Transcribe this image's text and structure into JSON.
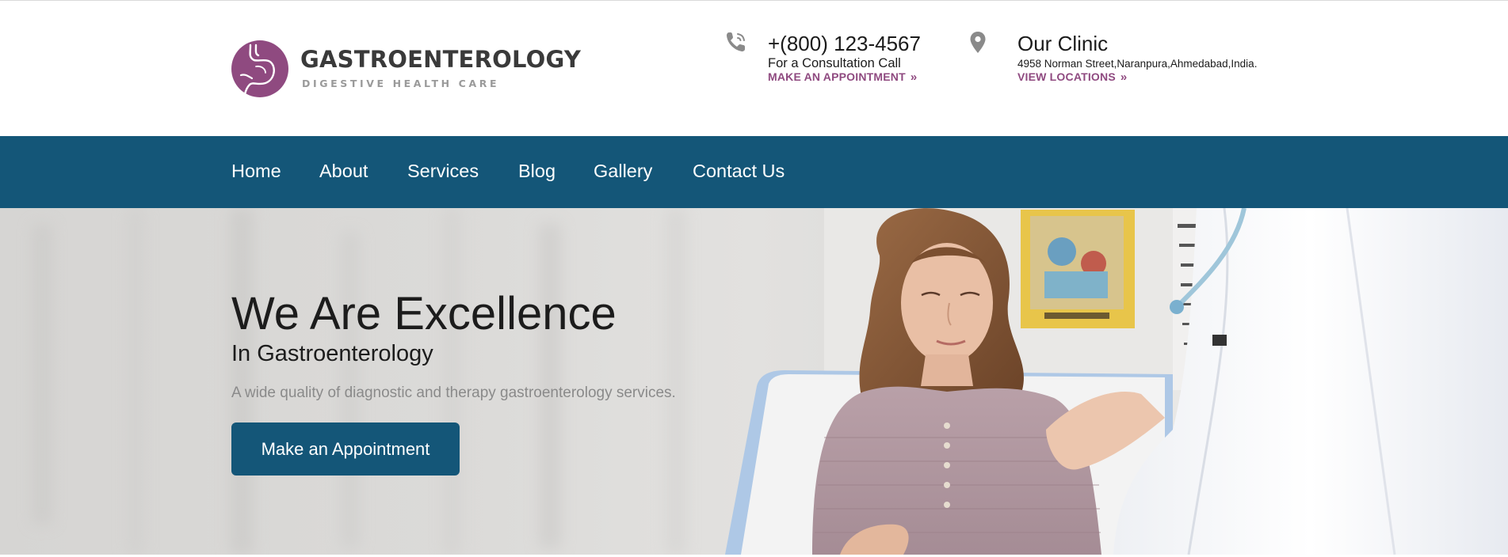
{
  "brand": {
    "name": "GASTROENTEROLOGY",
    "tagline": "DIGESTIVE HEALTH CARE",
    "color": "#8f4a80"
  },
  "header": {
    "phone": {
      "icon": "phone-icon",
      "number": "+(800) 123-4567",
      "caption": "For a Consultation Call",
      "link_label": "MAKE AN APPOINTMENT"
    },
    "clinic": {
      "icon": "map-pin-icon",
      "title": "Our Clinic",
      "address": "4958 Norman Street,Naranpura,Ahmedabad,India.",
      "link_label": "VIEW LOCATIONS"
    }
  },
  "nav": {
    "color": "#145678",
    "items": [
      {
        "label": "Home"
      },
      {
        "label": "About"
      },
      {
        "label": "Services"
      },
      {
        "label": "Blog"
      },
      {
        "label": "Gallery"
      },
      {
        "label": "Contact Us"
      }
    ]
  },
  "hero": {
    "title": "We Are Excellence",
    "subtitle": "In Gastroenterology",
    "description": "A wide quality of diagnostic and therapy gastroenterology services.",
    "button_label": "Make an Appointment"
  }
}
